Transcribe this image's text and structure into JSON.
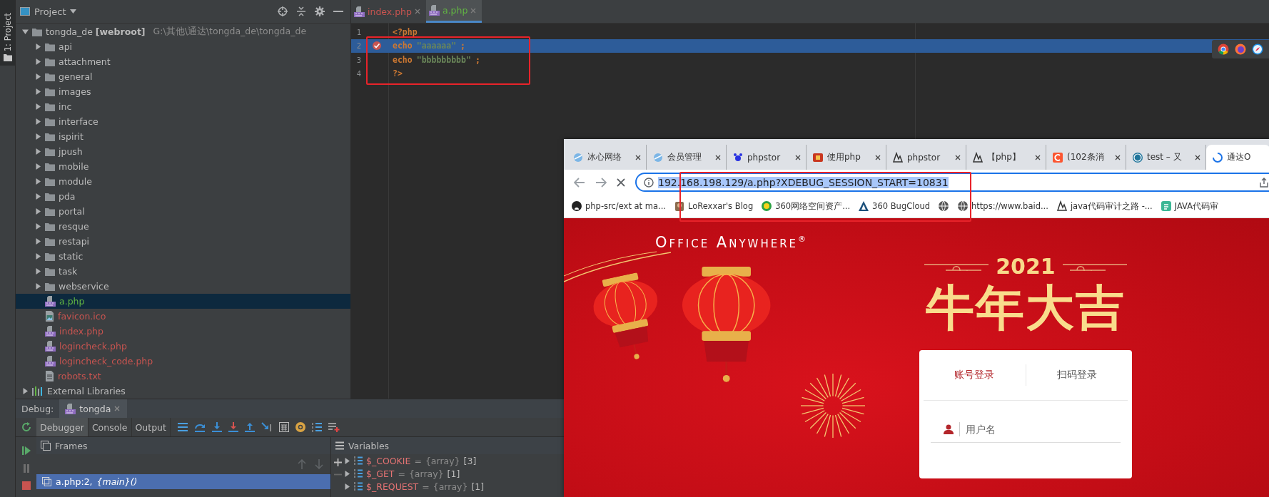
{
  "side_strip": {
    "label": "1: Project"
  },
  "project": {
    "title": "Project",
    "tree": [
      {
        "kind": "root",
        "name": "tongda_de **[webroot]**",
        "path": "G:\\其他\\通达\\tongda_de\\tongda_de",
        "expanded": true,
        "selected": false,
        "children": [
          {
            "kind": "folder",
            "name": "api",
            "expanded": false,
            "selected": false
          },
          {
            "kind": "folder",
            "name": "attachment",
            "expanded": false,
            "selected": false
          },
          {
            "kind": "folder",
            "name": "general",
            "expanded": false,
            "selected": false
          },
          {
            "kind": "folder",
            "name": "images",
            "expanded": false,
            "selected": false
          },
          {
            "kind": "folder",
            "name": "inc",
            "expanded": false,
            "selected": false
          },
          {
            "kind": "folder",
            "name": "interface",
            "expanded": false,
            "selected": false
          },
          {
            "kind": "folder",
            "name": "ispirit",
            "expanded": false,
            "selected": false
          },
          {
            "kind": "folder",
            "name": "jpush",
            "expanded": false,
            "selected": false
          },
          {
            "kind": "folder",
            "name": "mobile",
            "expanded": false,
            "selected": false
          },
          {
            "kind": "folder",
            "name": "module",
            "expanded": false,
            "selected": false
          },
          {
            "kind": "folder",
            "name": "pda",
            "expanded": false,
            "selected": false
          },
          {
            "kind": "folder",
            "name": "portal",
            "expanded": false,
            "selected": false
          },
          {
            "kind": "folder",
            "name": "resque",
            "expanded": false,
            "selected": false
          },
          {
            "kind": "folder",
            "name": "restapi",
            "expanded": false,
            "selected": false
          },
          {
            "kind": "folder",
            "name": "static",
            "expanded": false,
            "selected": false
          },
          {
            "kind": "folder",
            "name": "task",
            "expanded": false,
            "selected": false
          },
          {
            "kind": "folder",
            "name": "webservice",
            "expanded": false,
            "selected": false
          },
          {
            "kind": "php",
            "name": "a.php",
            "color": "#62b543",
            "selected": true
          },
          {
            "kind": "image",
            "name": "favicon.ico",
            "color": "#c75450",
            "selected": false
          },
          {
            "kind": "php",
            "name": "index.php",
            "color": "#c75450",
            "selected": false
          },
          {
            "kind": "php",
            "name": "logincheck.php",
            "color": "#c75450",
            "selected": false
          },
          {
            "kind": "php",
            "name": "logincheck_code.php",
            "color": "#c75450",
            "selected": false
          },
          {
            "kind": "text",
            "name": "robots.txt",
            "color": "#c75450",
            "selected": false
          }
        ]
      },
      {
        "kind": "library",
        "name": "External Libraries",
        "expanded": false,
        "selected": false
      }
    ]
  },
  "editor": {
    "tabs": [
      {
        "name": "index.php",
        "color": "#c75450",
        "selected": false
      },
      {
        "name": "a.php",
        "color": "#62b543",
        "selected": true
      }
    ],
    "lines": [
      {
        "number": "1",
        "current": false,
        "breakpoint": false,
        "tokens": [
          {
            "color": "#cc7832",
            "text": "<?php"
          }
        ]
      },
      {
        "number": "2",
        "current": true,
        "breakpoint": true,
        "tokens": [
          {
            "color": "#cc7832",
            "text": "echo"
          },
          {
            "color": "#6a8759",
            "text": "\"aaaaaa\""
          },
          {
            "color": "#cc7832",
            "text": ";"
          }
        ]
      },
      {
        "number": "3",
        "current": false,
        "breakpoint": false,
        "tokens": [
          {
            "color": "#cc7832",
            "text": "echo"
          },
          {
            "color": "#6a8759",
            "text": "\"bbbbbbbbb\""
          },
          {
            "color": "#cc7832",
            "text": ";"
          }
        ]
      },
      {
        "number": "4",
        "current": false,
        "breakpoint": false,
        "tokens": [
          {
            "color": "#cc7832",
            "text": "?>"
          }
        ]
      }
    ]
  },
  "debug": {
    "label": "Debug:",
    "session": "tongda",
    "tool_tabs": [
      {
        "label": "Debugger",
        "selected": true
      },
      {
        "label": "Console",
        "selected": false
      },
      {
        "label": "Output",
        "selected": false
      }
    ],
    "frames_title": "Frames",
    "frames": [
      {
        "label": "a.php:2, *{main}()*",
        "selected": true
      }
    ],
    "variables_title": "Variables",
    "variables": [
      {
        "name": "$_COOKIE",
        "equals": "=",
        "type": "{array}",
        "count": "[3]"
      },
      {
        "name": "$_GET",
        "equals": "=",
        "type": "{array}",
        "count": "[1]"
      },
      {
        "name": "$_REQUEST",
        "equals": "=",
        "type": "{array}",
        "count": "[1]"
      }
    ]
  },
  "browser": {
    "tabs": [
      {
        "label": "冰心网络",
        "selected": false
      },
      {
        "label": "会员管理",
        "selected": false
      },
      {
        "label": "phpstor",
        "selected": false
      },
      {
        "label": "使用php",
        "selected": false
      },
      {
        "label": "phpstor",
        "selected": false
      },
      {
        "label": "【php】",
        "selected": false
      },
      {
        "label": "(102条消",
        "selected": false
      },
      {
        "label": "test – 又",
        "selected": false
      },
      {
        "label": "通达O",
        "selected": true
      }
    ],
    "address": {
      "url": "192.168.198.129/a.php?XDEBUG_SESSION_START=10831",
      "selected": true
    },
    "bookmarks": [
      {
        "kind": "link",
        "label": "php-src/ext at ma..."
      },
      {
        "kind": "link",
        "label": "LoRexxar's Blog"
      },
      {
        "kind": "link",
        "label": "360网络空间资产..."
      },
      {
        "kind": "link",
        "label": "360 BugCloud"
      },
      {
        "kind": "icon"
      },
      {
        "kind": "link",
        "label": "https://www.baid..."
      },
      {
        "kind": "link",
        "label": "java代码审计之路 -..."
      },
      {
        "kind": "link",
        "label": "JAVA代码审"
      }
    ],
    "page": {
      "logo": "Office Anywhere$^{®}$",
      "year": "2021",
      "slogan": "牛年大吉",
      "login_tabs": [
        {
          "label": "账号登录",
          "selected": true
        },
        {
          "label": "扫码登录",
          "selected": false
        }
      ],
      "username": {
        "placeholder": "用户名"
      }
    }
  }
}
